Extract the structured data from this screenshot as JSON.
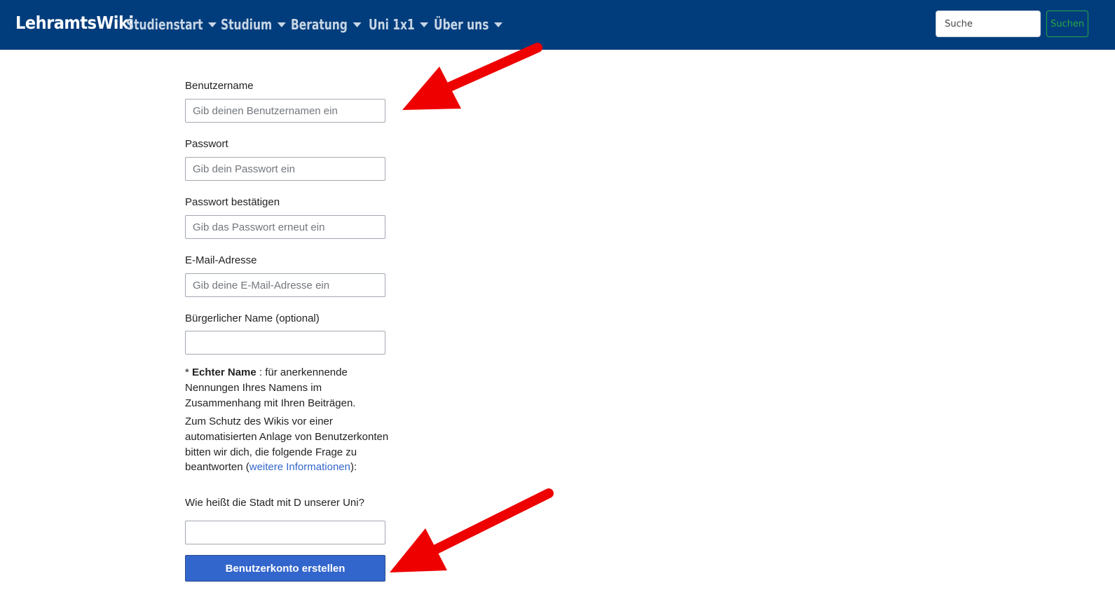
{
  "navbar": {
    "brand": "LehramtsWiki",
    "items": [
      {
        "label": "Studienstart"
      },
      {
        "label": "Studium"
      },
      {
        "label": "Beratung"
      },
      {
        "label": "Uni 1x1"
      },
      {
        "label": "Über uns"
      }
    ],
    "search_placeholder": "Suche",
    "search_button": "Suchen"
  },
  "form": {
    "username": {
      "label": "Benutzername",
      "placeholder": "Gib deinen Benutzernamen ein"
    },
    "password": {
      "label": "Passwort",
      "placeholder": "Gib dein Passwort ein"
    },
    "password_confirm": {
      "label": "Passwort bestätigen",
      "placeholder": "Gib das Passwort erneut ein"
    },
    "email": {
      "label": "E-Mail-Adresse",
      "placeholder": "Gib deine E-Mail-Adresse ein"
    },
    "realname": {
      "label": "Bürgerlicher Name (optional)",
      "placeholder": ""
    },
    "realname_help": {
      "prefix": "* ",
      "bold": "Echter Name",
      "rest": " : für anerkennende Nennungen Ihres Namens im Zusammenhang mit Ihren Beiträgen."
    },
    "captcha_info": {
      "text": "Zum Schutz des Wikis vor einer automatisierten Anlage von Benutzerkonten bitten wir dich, die folgende Frage zu beantworten (",
      "link": "weitere Informationen",
      "suffix": "):"
    },
    "captcha_question": "Wie heißt die Stadt mit D unserer Uni?",
    "captcha_placeholder": "",
    "submit": "Benutzerkonto erstellen"
  },
  "colors": {
    "navbar": "#013d7c",
    "accent": "#3366cc",
    "search_button": "#28a745",
    "annotation_arrow": "#ee0000"
  }
}
